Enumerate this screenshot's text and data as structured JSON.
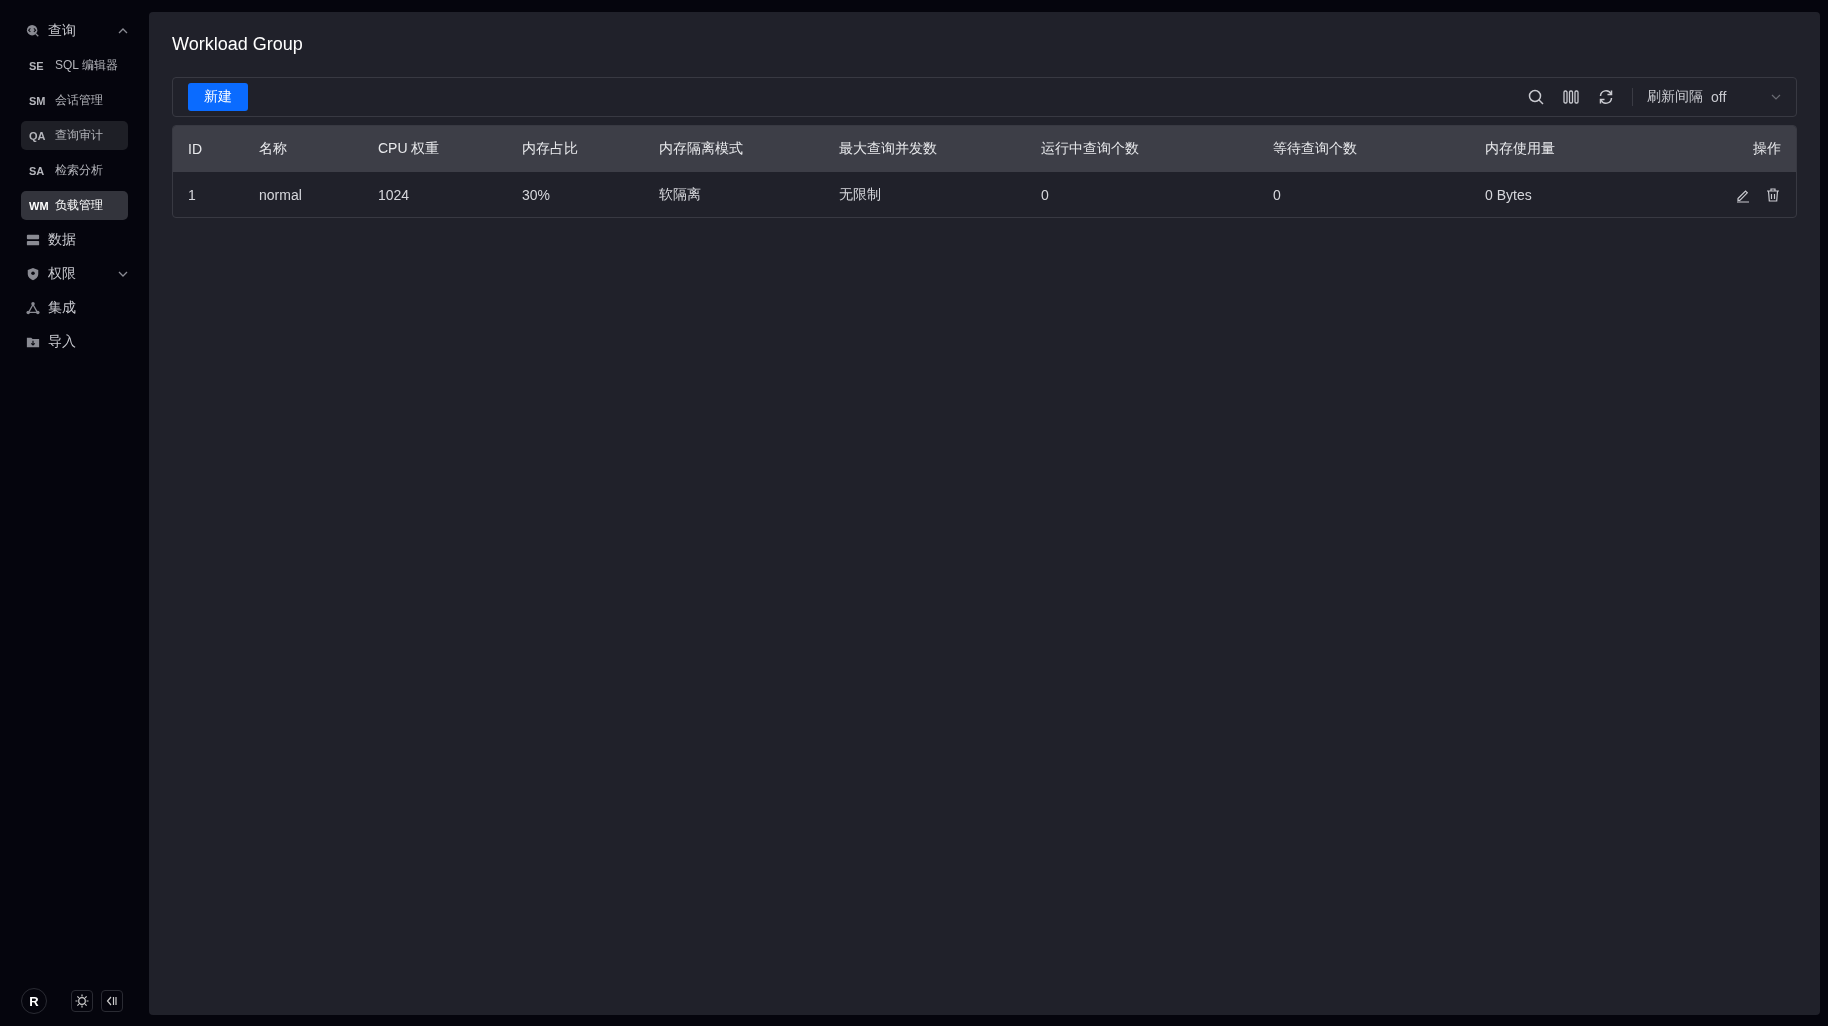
{
  "sidebar": {
    "items": [
      {
        "kind": "group",
        "label": "查询",
        "expanded": true,
        "children": [
          {
            "abbr": "SE",
            "label": "SQL 编辑器",
            "selected": false,
            "hovered": false
          },
          {
            "abbr": "SM",
            "label": "会话管理",
            "selected": false,
            "hovered": false
          },
          {
            "abbr": "QA",
            "label": "查询审计",
            "selected": false,
            "hovered": true
          },
          {
            "abbr": "SA",
            "label": "检索分析",
            "selected": false,
            "hovered": false
          },
          {
            "abbr": "WM",
            "label": "负载管理",
            "selected": true,
            "hovered": false
          }
        ]
      },
      {
        "kind": "link",
        "label": "数据"
      },
      {
        "kind": "group",
        "label": "权限",
        "expanded": false
      },
      {
        "kind": "link",
        "label": "集成"
      },
      {
        "kind": "link",
        "label": "导入"
      }
    ],
    "footer": {
      "avatar": "R"
    }
  },
  "page": {
    "title": "Workload Group",
    "toolbar": {
      "new_button": "新建",
      "refresh_label": "刷新间隔",
      "refresh_value": "off"
    },
    "table": {
      "columns": [
        "ID",
        "名称",
        "CPU 权重",
        "内存占比",
        "内存隔离模式",
        "最大查询并发数",
        "运行中查询个数",
        "等待查询个数",
        "内存使用量",
        "操作"
      ],
      "rows": [
        {
          "cells": [
            "1",
            "normal",
            "1024",
            "30%",
            "软隔离",
            "无限制",
            "0",
            "0",
            "0 Bytes"
          ]
        }
      ]
    }
  }
}
